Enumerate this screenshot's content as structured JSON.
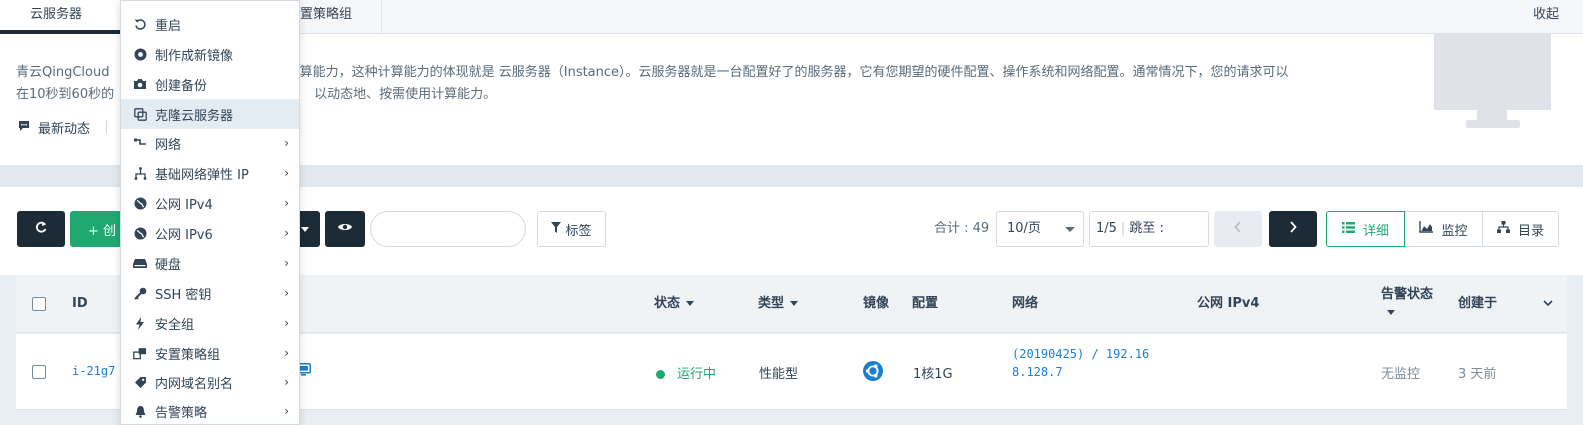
{
  "tabs": {
    "active": "云服务器",
    "second": "置策略组",
    "collapse": "收起"
  },
  "intro": {
    "line1_left": "青云QingCloud ",
    "line1_right": "的计算能力，这种计算能力的体现就是 云服务器（Instance）。云服务器就是一台配置好了的服务器，它有您期望的硬件配置、操作系统和网络配置。通常情况下，您的请求可以",
    "line2_left": "在10秒到60秒的",
    "line2_right": "以动态地、按需使用计算能力。",
    "news": "最新动态"
  },
  "toolbar": {
    "create_label": "+ 创",
    "tag_label": "标签",
    "search_placeholder": "",
    "total": "合计 : 49",
    "pagesize": "10/页",
    "page": "1/5",
    "jump": "跳至 :",
    "views": [
      "详细",
      "监控",
      "目录"
    ]
  },
  "table": {
    "headers": {
      "id": "ID",
      "status": "状态",
      "type": "类型",
      "image": "镜像",
      "config": "配置",
      "network": "网络",
      "public_ipv4": "公网 IPv4",
      "alarm": "告警状态",
      "created": "创建于"
    },
    "rows": [
      {
        "id": "i-21g7",
        "status": "运行中",
        "type": "性能型",
        "config": "1核1G",
        "network_line1": "(20190425) / 192.16",
        "network_line2": "8.128.7",
        "alarm": "无监控",
        "created": "3 天前"
      }
    ]
  },
  "menu": {
    "items": [
      {
        "label": "重启",
        "icon": "restart-icon",
        "has_submenu": false
      },
      {
        "label": "制作成新镜像",
        "icon": "record-icon",
        "has_submenu": false
      },
      {
        "label": "创建备份",
        "icon": "camera-icon",
        "has_submenu": false
      },
      {
        "label": "克隆云服务器",
        "icon": "copy-icon",
        "has_submenu": false
      },
      {
        "label": "网络",
        "icon": "network-icon",
        "has_submenu": true
      },
      {
        "label": "基础网络弹性 IP",
        "icon": "sitemap-icon",
        "has_submenu": true
      },
      {
        "label": "公网 IPv4",
        "icon": "globe-icon",
        "has_submenu": true
      },
      {
        "label": "公网 IPv6",
        "icon": "globe-icon",
        "has_submenu": true
      },
      {
        "label": "硬盘",
        "icon": "disk-icon",
        "has_submenu": true
      },
      {
        "label": "SSH 密钥",
        "icon": "key-icon",
        "has_submenu": true
      },
      {
        "label": "安全组",
        "icon": "bolt-icon",
        "has_submenu": true
      },
      {
        "label": "安置策略组",
        "icon": "group-icon",
        "has_submenu": true
      },
      {
        "label": "内网域名别名",
        "icon": "tag-icon",
        "has_submenu": true
      },
      {
        "label": "告警策略",
        "icon": "bell-icon",
        "has_submenu": true
      }
    ],
    "hovered_index": 3
  },
  "colors": {
    "accent_green": "#1fa971",
    "dark": "#1d2b36",
    "link_blue": "#1b7fd0"
  }
}
